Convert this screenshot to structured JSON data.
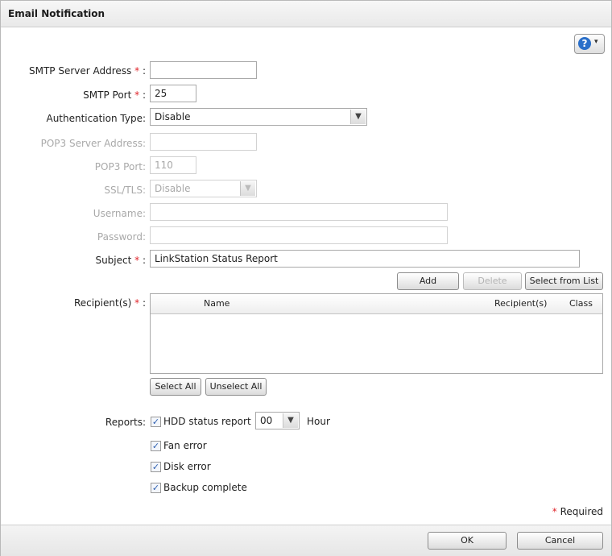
{
  "title": "Email Notification",
  "help": {
    "glyph": "?",
    "caret": "▾"
  },
  "required_marker": "*",
  "form": {
    "smtp_server": {
      "label": "SMTP Server Address",
      "value": ""
    },
    "smtp_port": {
      "label": "SMTP Port",
      "value": "25"
    },
    "auth_type": {
      "label": "Authentication Type:",
      "value": "Disable"
    },
    "pop3_server": {
      "label": "POP3 Server Address:",
      "value": ""
    },
    "pop3_port": {
      "label": "POP3 Port:",
      "value": "110"
    },
    "ssl_tls": {
      "label": "SSL/TLS:",
      "value": "Disable"
    },
    "username": {
      "label": "Username:",
      "value": ""
    },
    "password": {
      "label": "Password:",
      "value": ""
    },
    "subject": {
      "label": "Subject",
      "value": "LinkStation Status Report"
    }
  },
  "recipients": {
    "label": "Recipient(s)",
    "buttons": {
      "add": "Add",
      "delete": "Delete",
      "select_from_list": "Select from List"
    },
    "columns": {
      "name": "Name",
      "recipients": "Recipient(s)",
      "class": "Class"
    },
    "select_all": "Select All",
    "unselect_all": "Unselect All"
  },
  "reports": {
    "label": "Reports:",
    "hdd_status": {
      "label": "HDD status report",
      "checked": true,
      "hour": "00",
      "hour_unit": "Hour"
    },
    "fan_error": {
      "label": "Fan error",
      "checked": true
    },
    "disk_error": {
      "label": "Disk error",
      "checked": true
    },
    "backup_complete": {
      "label": "Backup complete",
      "checked": true
    }
  },
  "required_note": "Required",
  "footer": {
    "ok": "OK",
    "cancel": "Cancel"
  },
  "colors": {
    "required": "#e0242a",
    "help_blue": "#2a6fc9",
    "disabled_text": "#a9a9a9"
  }
}
